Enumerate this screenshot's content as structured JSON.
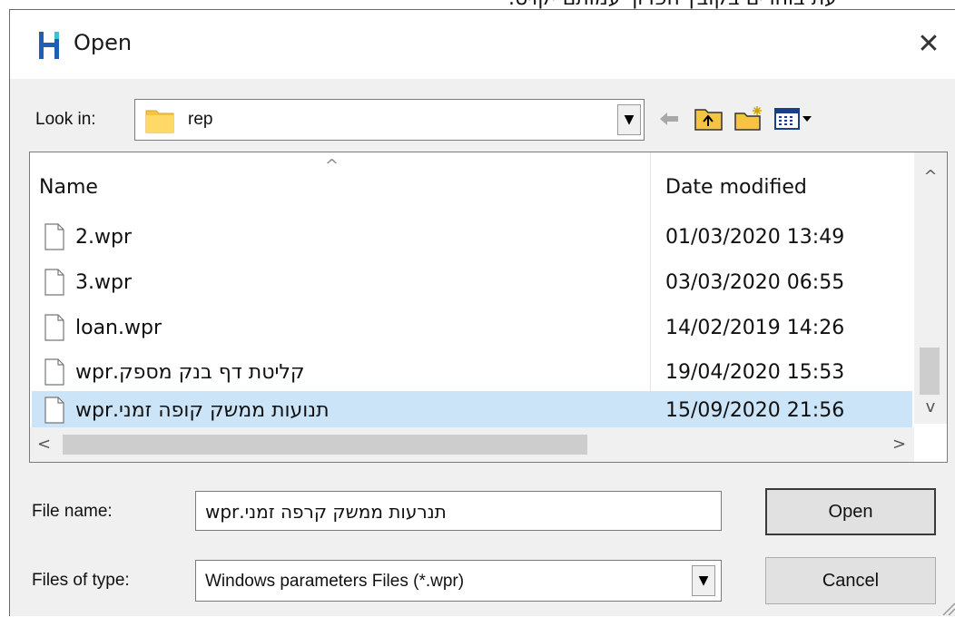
{
  "top_text": "עת בוחרים בקובץ הפרוך עמותם יקויט.",
  "dialog": {
    "title": "Open",
    "close_symbol": "✕"
  },
  "look_in": {
    "label": "Look in:",
    "value": "rep",
    "dropdown_symbol": "▼"
  },
  "toolbar": {
    "back_icon": "back-arrow-icon",
    "up_icon": "up-folder-icon",
    "new_folder_icon": "new-folder-icon",
    "view_menu_icon": "view-menu-icon"
  },
  "file_list": {
    "columns": {
      "name": "Name",
      "date": "Date modified"
    },
    "sort_symbol": "^",
    "files": [
      {
        "name": "2.wpr",
        "date": "01/03/2020 13:49",
        "selected": false
      },
      {
        "name": "3.wpr",
        "date": "03/03/2020 06:55",
        "selected": false
      },
      {
        "name": "loan.wpr",
        "date": "14/02/2019 14:26",
        "selected": false
      },
      {
        "name": "קליטת דף בנק מספק.wpr",
        "date": "19/04/2020 15:53",
        "selected": false
      },
      {
        "name": "תנועות ממשק קופה זמני.wpr",
        "date": "15/09/2020 21:56",
        "selected": true
      }
    ],
    "scroll_up": "^",
    "scroll_down": "v",
    "scroll_left": "<",
    "scroll_right": ">"
  },
  "file_name": {
    "label": "File name:",
    "value": "תנרעות ממשק קרפה זמני.wpr"
  },
  "files_of_type": {
    "label": "Files of type:",
    "value": "Windows parameters Files (*.wpr)",
    "dropdown_symbol": "▼"
  },
  "buttons": {
    "open": "Open",
    "cancel": "Cancel"
  },
  "colors": {
    "selection": "#cce4f7",
    "dialog_bg": "#f0f0f0",
    "folder": "#f5c542",
    "app_icon": "#1e5fb4"
  }
}
